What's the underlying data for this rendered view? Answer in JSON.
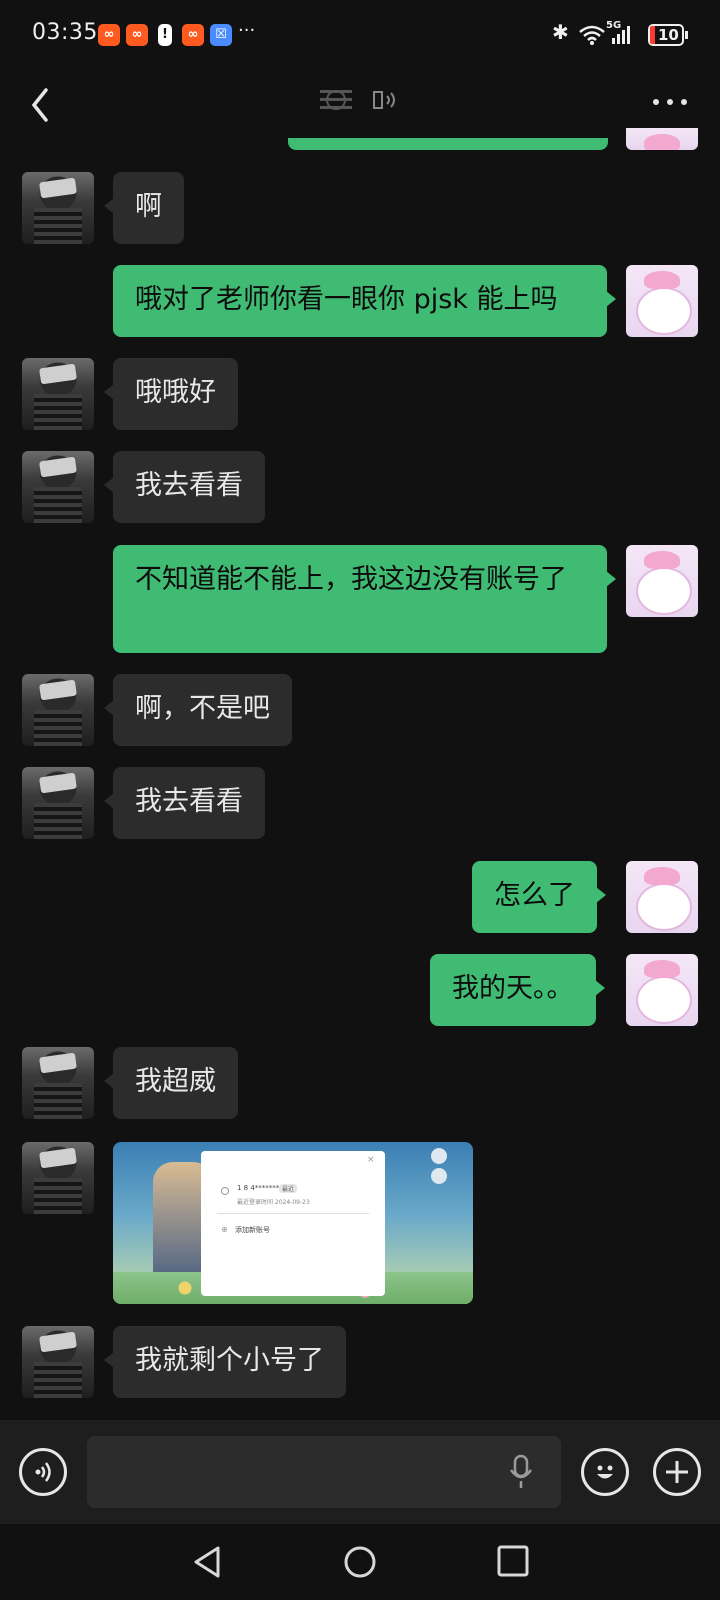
{
  "status": {
    "time": "03:35",
    "app_icons": [
      "app-badge-icon",
      "app-badge-icon",
      "alert-icon",
      "app-badge-icon",
      "shield-app-icon"
    ],
    "more_label": "···",
    "network": "5G",
    "battery": "10"
  },
  "nav": {
    "title_icon": "blurred-title",
    "sound_icon": "speaker-icon"
  },
  "messages": [
    {
      "side": "left",
      "text": "啊"
    },
    {
      "side": "right",
      "text": "哦对了老师你看一眼你 pjsk 能上吗"
    },
    {
      "side": "left",
      "text": "哦哦好"
    },
    {
      "side": "left",
      "text": "我去看看"
    },
    {
      "side": "right",
      "text": "不知道能不能上，我这边没有账号了"
    },
    {
      "side": "left",
      "text": "啊，不是吧"
    },
    {
      "side": "left",
      "text": "我去看看"
    },
    {
      "side": "right",
      "text": "怎么了"
    },
    {
      "side": "right",
      "text": "我的天。。"
    },
    {
      "side": "left",
      "text": "我超威"
    },
    {
      "side": "left",
      "type": "image",
      "image": "game-login-screenshot"
    },
    {
      "side": "left",
      "text": "我就剩个小号了"
    }
  ],
  "thumb": {
    "account_line": "1 8 4*******5 1",
    "badge": "最近",
    "last_login": "最近登录时间 2024-09-23",
    "add_account": "添加新账号"
  },
  "input": {
    "placeholder": ""
  },
  "colors": {
    "background": "#111111",
    "bubble_left": "#2c2c2c",
    "bubble_right": "#3fbb73",
    "input_bar": "#1e1e1e"
  }
}
